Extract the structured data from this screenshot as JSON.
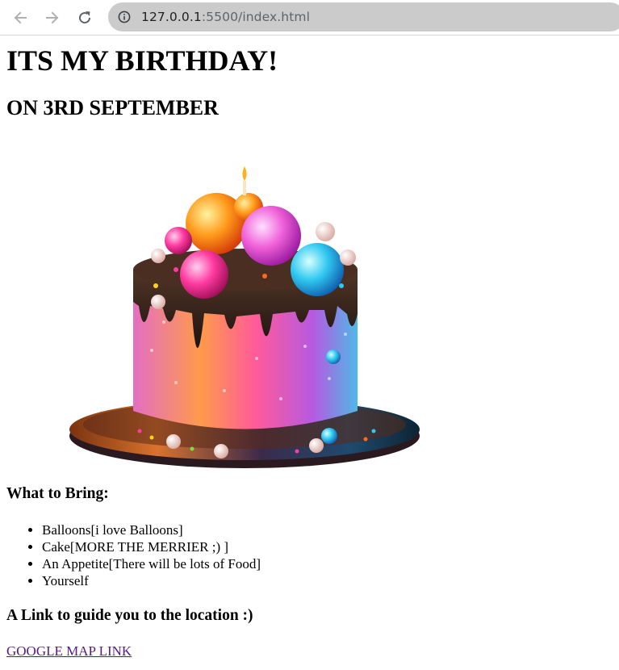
{
  "browser": {
    "url_host": "127.0.0.1",
    "url_path": ":5500/index.html",
    "back_icon": "arrow-left-icon",
    "forward_icon": "arrow-right-icon",
    "reload_icon": "reload-icon",
    "info_icon": "info-icon"
  },
  "page": {
    "title": "ITS MY BIRTHDAY!",
    "subtitle": "ON 3RD SEPTEMBER",
    "image": "birthday-cake",
    "bring_heading": "What to Bring:",
    "bring_items": [
      "Balloons[i love Balloons]",
      "Cake[MORE THE MERRIER ;) ]",
      "An Appetite[There will be lots of Food]",
      "Yourself"
    ],
    "link_heading": "A Link to guide you to the location :)",
    "link_text": "GOOGLE MAP LINK"
  },
  "colors": {
    "visited_link": "#551a8b",
    "omnibox_bg": "#cbcbcb"
  }
}
